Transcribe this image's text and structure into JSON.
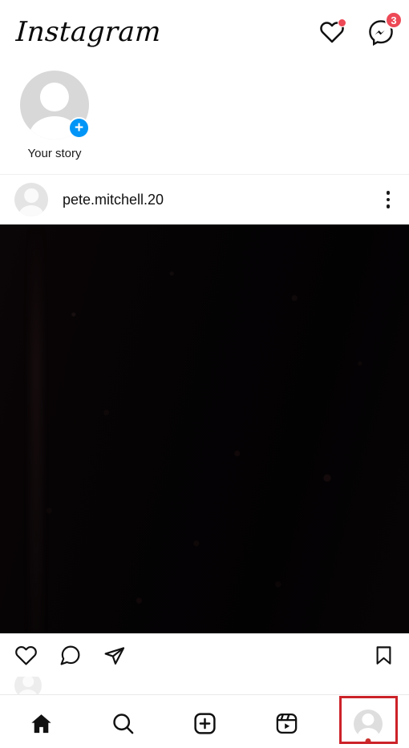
{
  "app": {
    "name": "Instagram"
  },
  "header": {
    "logo_text": "Instagram",
    "activity_icon": "heart-icon",
    "activity_badge_visible": true,
    "messenger_icon": "messenger-icon",
    "messenger_badge_count": "3",
    "badge_color": "#ed4956"
  },
  "stories": {
    "items": [
      {
        "label": "Your story",
        "avatar": "default-avatar-placeholder",
        "add_badge": "+",
        "add_badge_color": "#0095f6"
      }
    ]
  },
  "post": {
    "username": "pete.mitchell.20",
    "avatar": "default-avatar-placeholder",
    "more_options_icon": "kebab-menu-icon",
    "media": {
      "description": "dark photo",
      "background_color": "#050304"
    },
    "actions": {
      "like": "heart-icon",
      "comment": "comment-bubble-icon",
      "share": "share-paper-plane-icon",
      "save": "bookmark-icon"
    }
  },
  "bottom_nav": {
    "items": [
      {
        "name": "home",
        "icon": "home-icon",
        "active": true
      },
      {
        "name": "search",
        "icon": "search-icon",
        "active": false
      },
      {
        "name": "create",
        "icon": "plus-square-icon",
        "active": false
      },
      {
        "name": "reels",
        "icon": "reels-icon",
        "active": false
      },
      {
        "name": "profile",
        "icon": "profile-avatar-icon",
        "active": false,
        "notification_dot": true
      }
    ]
  },
  "annotation": {
    "highlight_target": "profile-tab",
    "color": "#cc2229"
  }
}
